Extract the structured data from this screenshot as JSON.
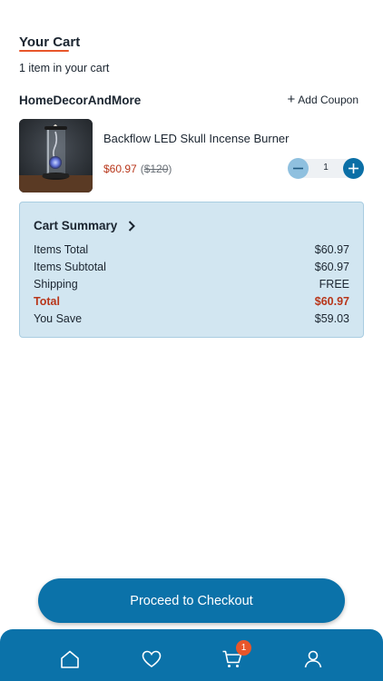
{
  "header": {
    "title": "Your Cart",
    "item_count_text": "1 item in your cart"
  },
  "store": {
    "name": "HomeDecorAndMore",
    "add_coupon_label": "Add Coupon",
    "add_coupon_icon": "plus-icon"
  },
  "product": {
    "name": "Backflow LED Skull Incense Burner",
    "price": "$60.97",
    "original_price_open": "(",
    "original_price": "$120",
    "original_price_close": ")",
    "quantity": "1",
    "minus_icon": "minus-icon",
    "plus_icon": "plus-icon"
  },
  "summary": {
    "title": "Cart Summary",
    "rows": [
      {
        "label": "Items Total",
        "value": "$60.97"
      },
      {
        "label": "Items Subtotal",
        "value": "$60.97"
      },
      {
        "label": "Shipping",
        "value": "FREE"
      },
      {
        "label": "Total",
        "value": "$60.97"
      },
      {
        "label": "You Save",
        "value": "$59.03"
      }
    ]
  },
  "checkout": {
    "label": "Proceed to Checkout"
  },
  "tabbar": {
    "items": [
      "home-icon",
      "heart-icon",
      "cart-icon",
      "user-icon"
    ],
    "cart_badge": "1"
  },
  "colors": {
    "brand_blue": "#0b72a9",
    "accent_orange": "#e8562a",
    "price_red": "#b8361a",
    "summary_bg": "#d2e6f1"
  }
}
